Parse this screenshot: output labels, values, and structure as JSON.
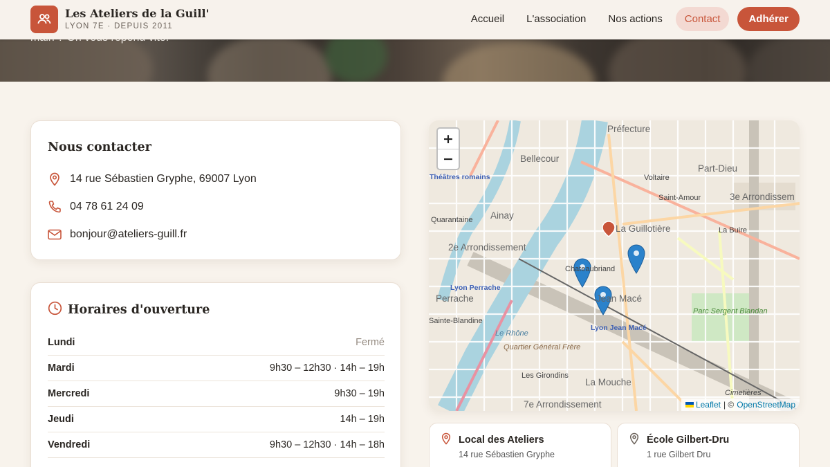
{
  "brand": {
    "name": "Les Ateliers de la Guill'",
    "tagline": "LYON 7E · DEPUIS 2011",
    "accent": "#c8553a"
  },
  "hero": {
    "text": "main ? On vous répond vite."
  },
  "nav": {
    "items": [
      {
        "label": "Accueil"
      },
      {
        "label": "L'association"
      },
      {
        "label": "Nos actions"
      },
      {
        "label": "Contact",
        "active": true
      }
    ],
    "cta": "Adhérer"
  },
  "contact": {
    "title": "Nous contacter",
    "address": "14 rue Sébastien Gryphe, 69007 Lyon",
    "phone": "04 78 61 24 09",
    "email": "bonjour@ateliers-guill.fr"
  },
  "hours": {
    "title": "Horaires d'ouverture",
    "rows": [
      {
        "day": "Lundi",
        "time": "Fermé"
      },
      {
        "day": "Mardi",
        "time": "9h30 – 12h30 · 14h – 19h"
      },
      {
        "day": "Mercredi",
        "time": "9h30 – 19h"
      },
      {
        "day": "Jeudi",
        "time": "14h – 19h"
      },
      {
        "day": "Vendredi",
        "time": "9h30 – 12h30 · 14h – 18h"
      }
    ]
  },
  "map": {
    "zoom_in": "+",
    "zoom_out": "−",
    "attribution": {
      "leaflet": "Leaflet",
      "separator": "| ©",
      "osm": "OpenStreetMap"
    },
    "labels": {
      "prefecture": "Préfecture",
      "bellecour": "Bellecour",
      "part_dieu": "Part-Dieu",
      "voltaire": "Voltaire",
      "saint_amour": "Saint-Amour",
      "arr3": "3e Arrondissem",
      "ainay": "Ainay",
      "quarantaine": "Quarantaine",
      "guillotiere": "La Guillotière",
      "la_buire": "La Buire",
      "arr2": "2e Arrondissement",
      "perrache": "Perrache",
      "lyon_perrache": "Lyon Perrache",
      "sainte_blandine": "Sainte-Blandine",
      "mace": "Jean Macé",
      "lyon_jean_mace": "Lyon Jean Macé",
      "chateaubriand": "Chateaubriand",
      "parc": "Parc Sergent Blandan",
      "quartier": "Quartier Général Frère",
      "girondins": "Les Girondins",
      "la_mouche": "La Mouche",
      "arr7": "7e Arrondissement",
      "theatres": "Théâtres romains",
      "rhone": "Le Rhône",
      "cimetieres": "Cimetières"
    }
  },
  "locations": [
    {
      "name": "Local des Ateliers",
      "address": "14 rue Sébastien Gryphe"
    },
    {
      "name": "École Gilbert-Dru",
      "address": "1 rue Gilbert Dru"
    }
  ]
}
